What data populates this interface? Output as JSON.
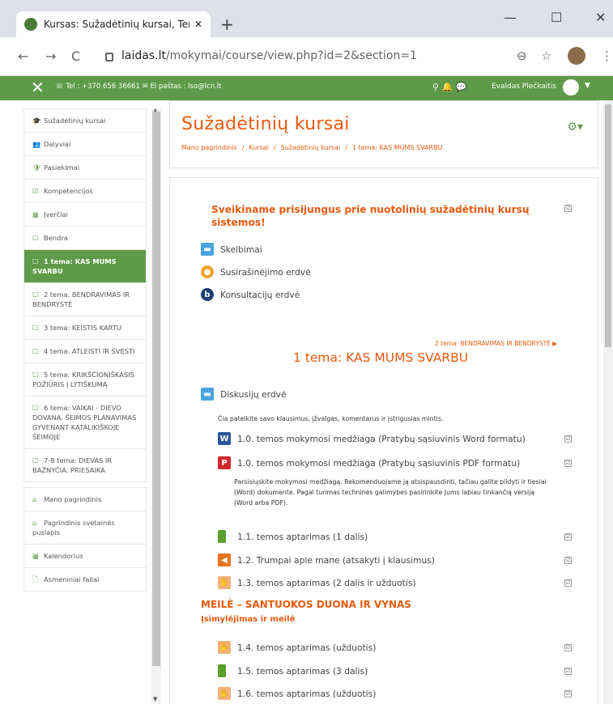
{
  "browser": {
    "tab_title": "Kursas: Sužadėtinių kursai, Tema:",
    "tab_close": "✕",
    "new_tab": "+",
    "win_min": "—",
    "win_max": "☐",
    "win_close": "✕",
    "url_host": "laidas.lt",
    "url_path": "/mokymai/course/view.php?id=2&section=1",
    "back": "←",
    "forward": "→",
    "reload": "C",
    "zoom": "⊖",
    "star": "☆",
    "menu": "⋮"
  },
  "topbar": {
    "close": "✕",
    "contact": "☏ Tel : +370 656 36661 ✉ El paštas : lso@lcn.lt",
    "icons": "⚲ 🔔 💬",
    "user": "Evaldas Plečkaitis",
    "caret": "▼"
  },
  "sidebar": {
    "items": [
      {
        "icon": "🎓",
        "label": "Sužadėtinių kursai"
      },
      {
        "icon": "👥",
        "label": "Dalyviai"
      },
      {
        "icon": "🛡",
        "label": "Pasiekimai"
      },
      {
        "icon": "☑",
        "label": "Kompetencijos"
      },
      {
        "icon": "▦",
        "label": "Įverčiai"
      },
      {
        "icon": "☐",
        "label": "Bendra"
      },
      {
        "icon": "☐",
        "label": "1 tema: KAS MUMS SVARBU"
      },
      {
        "icon": "☐",
        "label": "2 tema: BENDRAVIMAS IR BENDRYSTĖ"
      },
      {
        "icon": "☐",
        "label": "3 tema: KEISTIS KARTU"
      },
      {
        "icon": "☐",
        "label": "4 tema: ATLEISTI IR ŠVĘSTI"
      },
      {
        "icon": "☐",
        "label": "5 tema: KRIKŠČIONIŠKASIS POŽIŪRIS Į LYTIŠKUMĄ"
      },
      {
        "icon": "☐",
        "label": "6 tema: VAIKAI - DIEVO DOVANA. ŠEIMOS PLANAVIMAS GYVENANT KATALIKIŠKOJE ŠEIMOJE"
      },
      {
        "icon": "☐",
        "label": "7-8 tema: DIEVAS IR BAŽNYČIA. PRIESAIKA"
      },
      {
        "icon": "⌂",
        "label": "Mano pagrindinis"
      },
      {
        "icon": "⌂",
        "label": "Pagrindinis svetainės puslapis"
      },
      {
        "icon": "▦",
        "label": "Kalendorius"
      },
      {
        "icon": "🗋",
        "label": "Asmeniniai failai"
      }
    ]
  },
  "header": {
    "title": "Sužadėtinių kursai",
    "gear": "⚙▾",
    "crumbs": [
      "Mano pagrindinis",
      "Kursai",
      "Sužadėtinių kursai",
      "1 tema: KAS MUMS SVARBU"
    ],
    "sep": "/"
  },
  "general": {
    "welcome": "Sveikiname prisijungus prie nuotolinių sužadėtinių kursų sistemos!",
    "activities": [
      "Skelbimai",
      "Susirašinėjimo erdvė",
      "Konsultacijų erdvė"
    ]
  },
  "topic1": {
    "next_link": "2 tema: BENDRAVIMAS IR BENDRYSTĖ ▶",
    "title": "1 tema: KAS MUMS SVARBU",
    "forum": "Diskusijų erdvė",
    "forum_note": "Čia pateikite savo klausimus, įžvalgas, komentarus ir įstrigusias mintis.",
    "mat_word": "1.0. temos mokymosi medžiaga (Pratybų sąsiuvinis Word formatu)",
    "mat_pdf": "1.0. temos mokymosi medžiaga (Pratybų sąsiuvinis PDF formatu)",
    "mat_note": "Parsisiųskite mokymosi medžiagą. Rekomenduojame ją atsispausdinti, tačiau galite pildyti ir tiesiai (Word) dokumente. Pagal turimas technines galimybes pasirinkite Jums labiau tinkančią versiją (Word arba PDF).",
    "a11": "1.1. temos aptarimas (1 dalis)",
    "a12": "1.2. Trumpai apie mane (atsakyti į klausimus)",
    "a13": "1.3. temos aptarimas (2 dalis ir užduotis)",
    "section": "MEILĖ – SANTUOKOS DUONA IR VYNAS",
    "subsection": "Įsimylėjimas ir meilė",
    "a14": "1.4. temos aptarimas (užduotis)",
    "a15": "1.5. temos aptarimas (3 dalis)",
    "a16": "1.6. temos aptarimas (užduotis)"
  },
  "check": "☑"
}
